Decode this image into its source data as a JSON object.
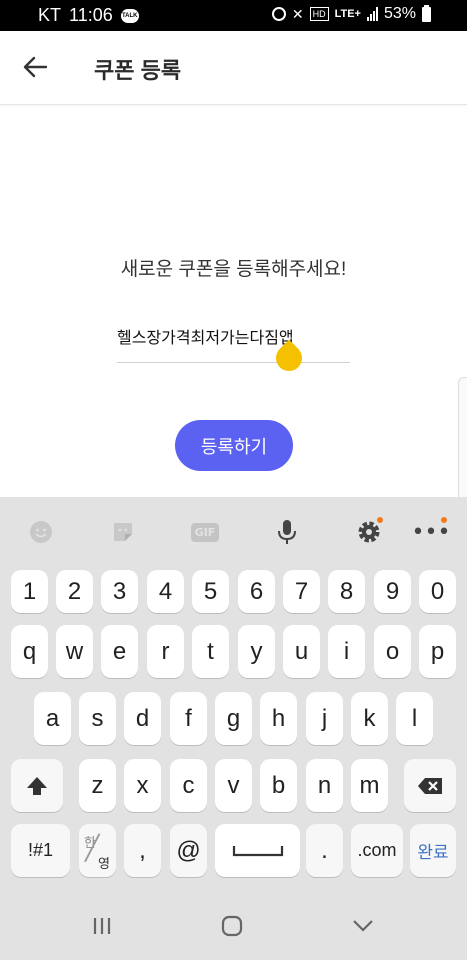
{
  "status_bar": {
    "carrier": "KT",
    "time": "11:06",
    "talk_badge": "TALK",
    "hd_label": "HD",
    "network": "LTE+",
    "battery": "53%"
  },
  "app_bar": {
    "title": "쿠폰 등록",
    "icons": {
      "back": "arrow-left-icon"
    }
  },
  "main": {
    "prompt": "새로운 쿠폰을 등록해주세요!",
    "coupon_input": {
      "value": "헬스장가격최저가는다짐앱",
      "placeholder": ""
    },
    "register_button": "등록하기",
    "colors": {
      "accent": "#5b61f0",
      "cursor_handle": "#f5c000"
    }
  },
  "keyboard": {
    "toolbar": [
      "emoji-icon",
      "sticker-icon",
      "gif-icon",
      "microphone-icon",
      "settings-icon",
      "more-icon"
    ],
    "gif_label": "GIF",
    "row_numbers": [
      "1",
      "2",
      "3",
      "4",
      "5",
      "6",
      "7",
      "8",
      "9",
      "0"
    ],
    "row_top": [
      "q",
      "w",
      "e",
      "r",
      "t",
      "y",
      "u",
      "i",
      "o",
      "p"
    ],
    "row_mid": [
      "a",
      "s",
      "d",
      "f",
      "g",
      "h",
      "j",
      "k",
      "l"
    ],
    "row_bottom": [
      "z",
      "x",
      "c",
      "v",
      "b",
      "n",
      "m"
    ],
    "symbols_key": "!#1",
    "lang_key_top": "한",
    "lang_key_bottom": "영",
    "comma_key": ",",
    "at_key": "@",
    "period_key": ".",
    "dotcom_key": ".com",
    "done_key": "완료"
  },
  "nav_bar": {
    "icons": [
      "recent-apps-icon",
      "home-icon",
      "back-chevron-icon"
    ]
  }
}
